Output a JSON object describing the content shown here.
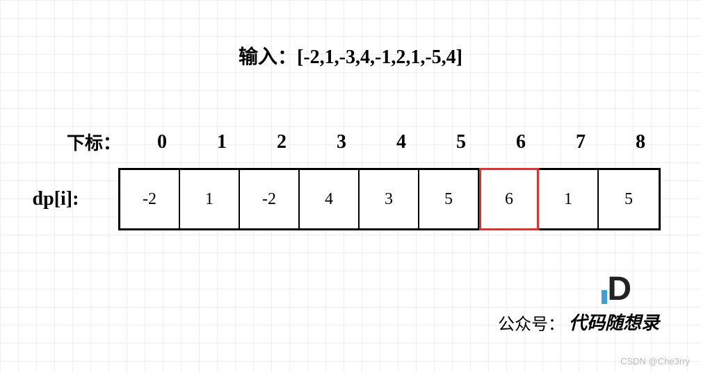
{
  "chart_data": {
    "type": "table",
    "title": "输入：[-2,1,-3,4,-1,2,1,-5,4]",
    "input_label": "输入：",
    "input_array": "[-2,1,-3,4,-1,2,1,-5,4]",
    "index_label": "下标：",
    "indices": [
      "0",
      "1",
      "2",
      "3",
      "4",
      "5",
      "6",
      "7",
      "8"
    ],
    "dp_label": "dp[i]:",
    "dp_values": [
      "-2",
      "1",
      "-2",
      "4",
      "3",
      "5",
      "6",
      "1",
      "5"
    ],
    "highlight_index": 6
  },
  "footer": {
    "label": "公众号：",
    "account": "代码随想录",
    "logo_letter": "D"
  },
  "watermark": "CSDN @Che3rry"
}
